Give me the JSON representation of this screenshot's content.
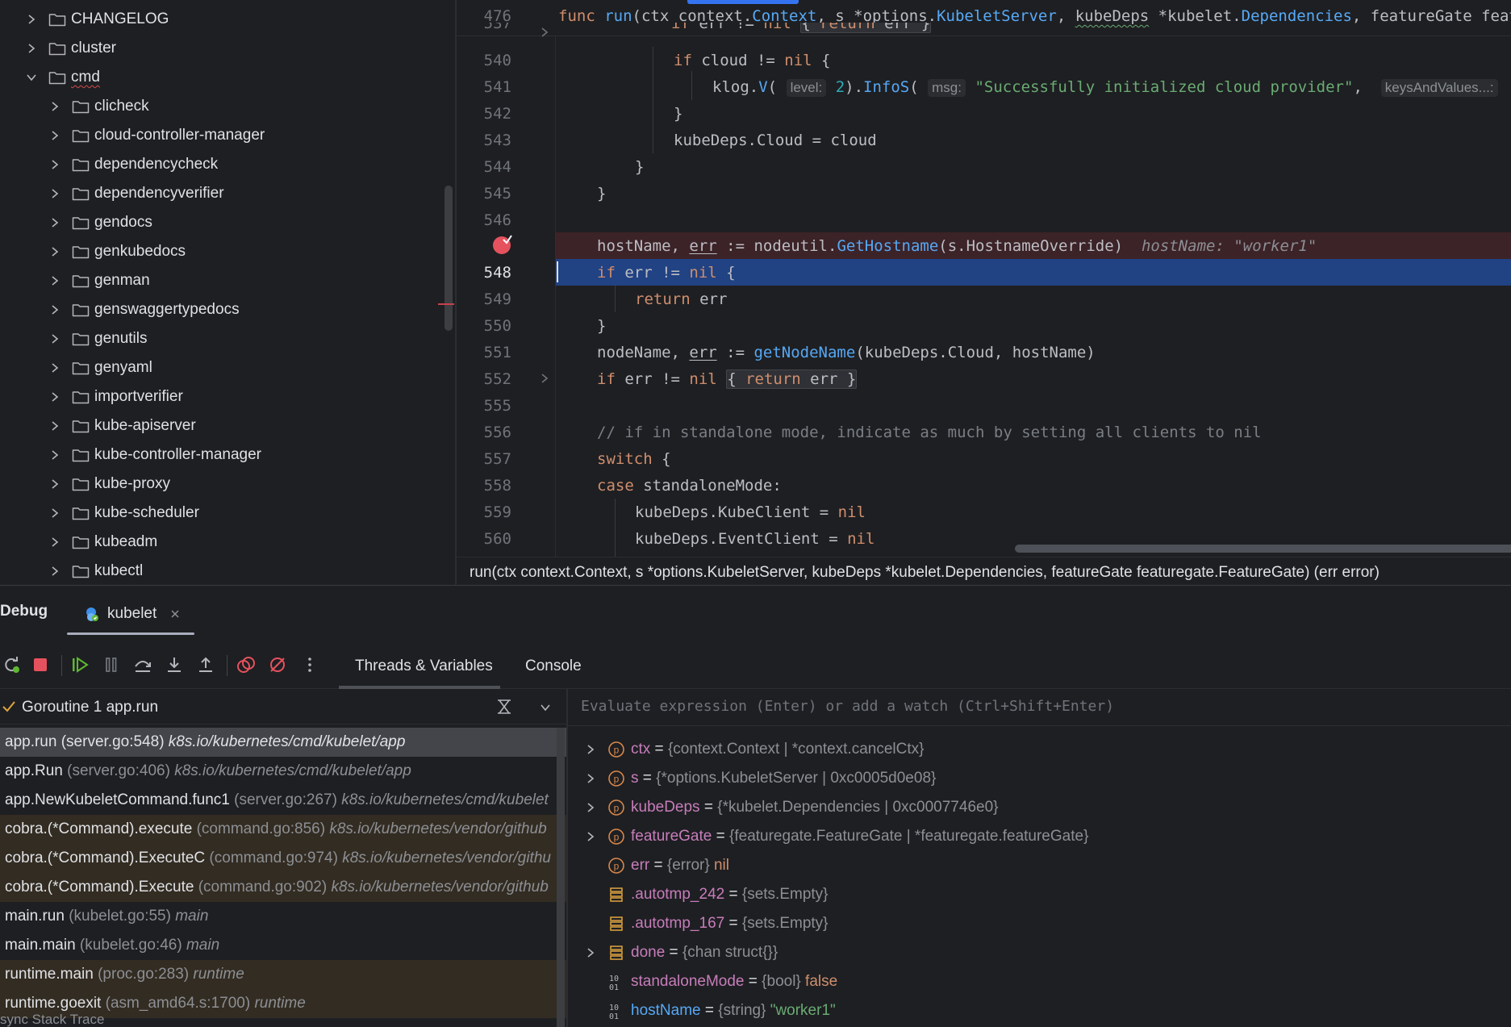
{
  "project_tree": {
    "items": [
      {
        "label": "CHANGELOG",
        "expanded": false,
        "level": 0
      },
      {
        "label": "cluster",
        "expanded": false,
        "level": 0
      },
      {
        "label": "cmd",
        "expanded": true,
        "level": 0
      },
      {
        "label": "clicheck",
        "expanded": false,
        "level": 1
      },
      {
        "label": "cloud-controller-manager",
        "expanded": false,
        "level": 1
      },
      {
        "label": "dependencycheck",
        "expanded": false,
        "level": 1
      },
      {
        "label": "dependencyverifier",
        "expanded": false,
        "level": 1
      },
      {
        "label": "gendocs",
        "expanded": false,
        "level": 1
      },
      {
        "label": "genkubedocs",
        "expanded": false,
        "level": 1
      },
      {
        "label": "genman",
        "expanded": false,
        "level": 1
      },
      {
        "label": "genswaggertypedocs",
        "expanded": false,
        "level": 1
      },
      {
        "label": "genutils",
        "expanded": false,
        "level": 1
      },
      {
        "label": "genyaml",
        "expanded": false,
        "level": 1
      },
      {
        "label": "importverifier",
        "expanded": false,
        "level": 1
      },
      {
        "label": "kube-apiserver",
        "expanded": false,
        "level": 1
      },
      {
        "label": "kube-controller-manager",
        "expanded": false,
        "level": 1
      },
      {
        "label": "kube-proxy",
        "expanded": false,
        "level": 1
      },
      {
        "label": "kube-scheduler",
        "expanded": false,
        "level": 1
      },
      {
        "label": "kubeadm",
        "expanded": false,
        "level": 1
      },
      {
        "label": "kubectl",
        "expanded": false,
        "level": 1
      }
    ]
  },
  "editor": {
    "sticky_line": {
      "num": "476",
      "text": "func run(ctx context.Context, s *options.KubeletServer, kubeDeps *kubelet.Dependencies, featureGate featuregate.FeatureGate) (err error) {"
    },
    "lines": [
      {
        "num": "537",
        "text": "if err != nil { return err }"
      },
      {
        "num": "540",
        "text": "if cloud != nil {"
      },
      {
        "num": "541",
        "text": "klog.V(2).InfoS(\"Successfully initialized cloud provider\", keysAndValues...)"
      },
      {
        "num": "542",
        "text": "}"
      },
      {
        "num": "543",
        "text": "kubeDeps.Cloud = cloud"
      },
      {
        "num": "544",
        "text": "}"
      },
      {
        "num": "545",
        "text": "}"
      },
      {
        "num": "546",
        "text": ""
      },
      {
        "num": "547",
        "text": "hostName, err := nodeutil.GetHostname(s.HostnameOverride)"
      },
      {
        "num": "548",
        "text": "if err != nil {"
      },
      {
        "num": "549",
        "text": "return err"
      },
      {
        "num": "550",
        "text": "}"
      },
      {
        "num": "551",
        "text": "nodeName, err := getNodeName(kubeDeps.Cloud, hostName)"
      },
      {
        "num": "552",
        "text": "if err != nil { return err }"
      },
      {
        "num": "555",
        "text": ""
      },
      {
        "num": "556",
        "text": "// if in standalone mode, indicate as much by setting all clients to nil"
      },
      {
        "num": "557",
        "text": "switch {"
      },
      {
        "num": "558",
        "text": "case standaloneMode:"
      },
      {
        "num": "559",
        "text": "kubeDeps.KubeClient = nil"
      },
      {
        "num": "560",
        "text": "kubeDeps.EventClient = nil"
      }
    ],
    "hints": {
      "level": "level:",
      "msg": "msg:",
      "keys": "keysAndValues...:"
    },
    "inline_value": "hostName: \"worker1\"",
    "breakpoint_line": "547",
    "execution_line": "548"
  },
  "breadcrumb": "run(ctx context.Context, s *options.KubeletServer, kubeDeps *kubelet.Dependencies, featureGate featuregate.FeatureGate) (err error)",
  "debug": {
    "title": "Debug",
    "session_tab": "kubelet",
    "view_tabs": [
      "Threads & Variables",
      "Console"
    ],
    "thread": "Goroutine 1 app.run",
    "watch_placeholder": "Evaluate expression (Enter) or add a watch (Ctrl+Shift+Enter)",
    "frames": [
      {
        "method": "app.run",
        "location": "(server.go:548)",
        "package": "k8s.io/kubernetes/cmd/kubelet/app",
        "selected": true,
        "library": false
      },
      {
        "method": "app.Run",
        "location": "(server.go:406)",
        "package": "k8s.io/kubernetes/cmd/kubelet/app",
        "selected": false,
        "library": false
      },
      {
        "method": "app.NewKubeletCommand.func1",
        "location": "(server.go:267)",
        "package": "k8s.io/kubernetes/cmd/kubelet",
        "selected": false,
        "library": false
      },
      {
        "method": "cobra.(*Command).execute",
        "location": "(command.go:856)",
        "package": "k8s.io/kubernetes/vendor/github",
        "selected": false,
        "library": true
      },
      {
        "method": "cobra.(*Command).ExecuteC",
        "location": "(command.go:974)",
        "package": "k8s.io/kubernetes/vendor/githu",
        "selected": false,
        "library": true
      },
      {
        "method": "cobra.(*Command).Execute",
        "location": "(command.go:902)",
        "package": "k8s.io/kubernetes/vendor/github",
        "selected": false,
        "library": true
      },
      {
        "method": "main.run",
        "location": "(kubelet.go:55)",
        "package": "main",
        "selected": false,
        "library": false
      },
      {
        "method": "main.main",
        "location": "(kubelet.go:46)",
        "package": "main",
        "selected": false,
        "library": false
      },
      {
        "method": "runtime.main",
        "location": "(proc.go:283)",
        "package": "runtime",
        "selected": false,
        "library": true
      },
      {
        "method": "runtime.goexit",
        "location": "(asm_amd64.s:1700)",
        "package": "runtime",
        "selected": false,
        "library": true
      }
    ],
    "async_label": "sync Stack Trace",
    "variables": [
      {
        "name": "ctx",
        "type": "{context.Context | *context.cancelCtx}",
        "value": "",
        "icon": "param",
        "expandable": true,
        "name_color": "field"
      },
      {
        "name": "s",
        "type": "{*options.KubeletServer | 0xc0005d0e08}",
        "value": "",
        "icon": "param",
        "expandable": true,
        "name_color": "field"
      },
      {
        "name": "kubeDeps",
        "type": "{*kubelet.Dependencies | 0xc0007746e0}",
        "value": "",
        "icon": "param",
        "expandable": true,
        "name_color": "field"
      },
      {
        "name": "featureGate",
        "type": "{featuregate.FeatureGate | *featuregate.featureGate}",
        "value": "",
        "icon": "param",
        "expandable": true,
        "name_color": "field"
      },
      {
        "name": "err",
        "type": "{error}",
        "value": "nil",
        "icon": "param",
        "expandable": false,
        "name_color": "field",
        "value_kind": "kw"
      },
      {
        "name": ".autotmp_242",
        "type": "{sets.Empty}",
        "value": "",
        "icon": "struct",
        "expandable": false,
        "name_color": "field"
      },
      {
        "name": ".autotmp_167",
        "type": "{sets.Empty}",
        "value": "",
        "icon": "struct",
        "expandable": false,
        "name_color": "field"
      },
      {
        "name": "done",
        "type": "{chan struct{}}",
        "value": "",
        "icon": "struct",
        "expandable": true,
        "name_color": "field"
      },
      {
        "name": "standaloneMode",
        "type": "{bool}",
        "value": "false",
        "icon": "primitive",
        "expandable": false,
        "name_color": "field",
        "value_kind": "kw"
      },
      {
        "name": "hostName",
        "type": "{string}",
        "value": "\"worker1\"",
        "icon": "primitive",
        "expandable": false,
        "name_color": "blue",
        "value_kind": "str"
      }
    ]
  },
  "colors": {
    "accent": "#3574f0",
    "execution_line": "#214283",
    "breakpoint_line": "#3c2328",
    "breakpoint": "#e5525e"
  }
}
